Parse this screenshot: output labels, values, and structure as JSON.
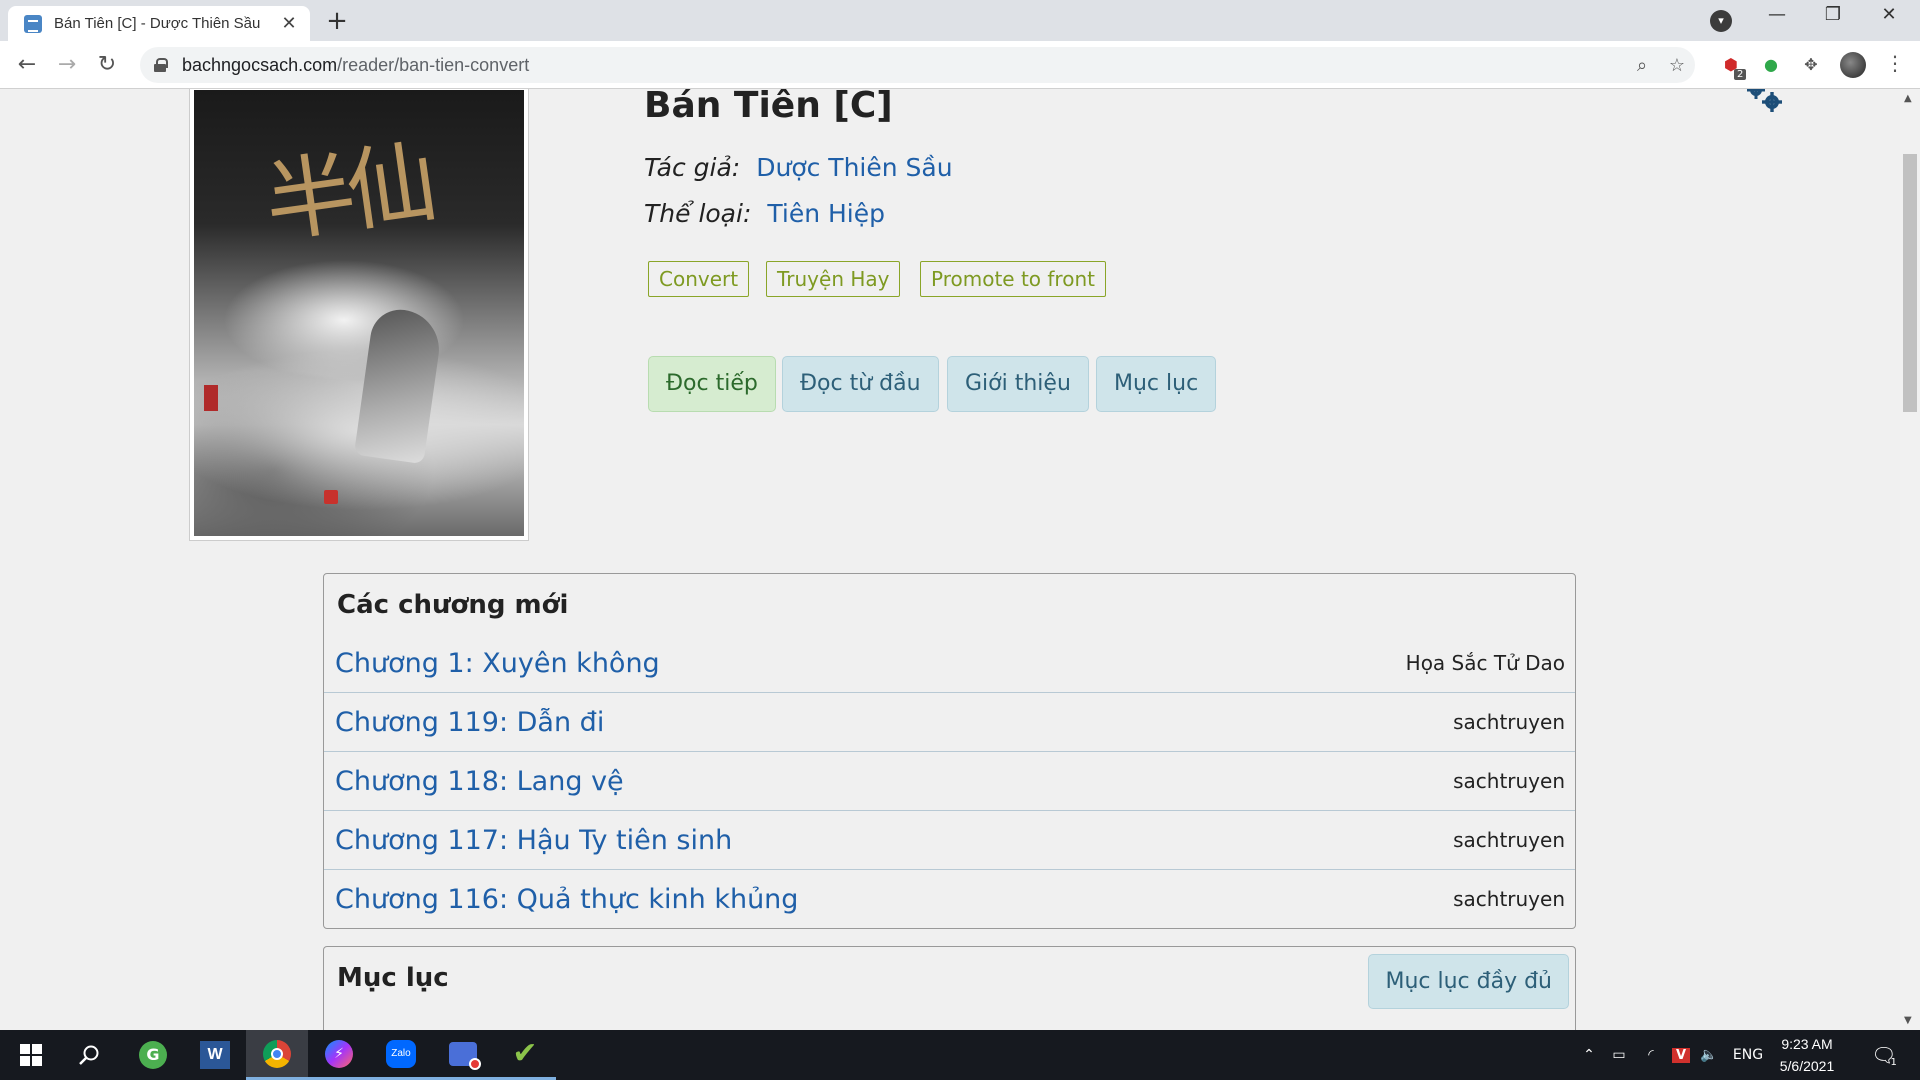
{
  "browser": {
    "tab_title": "Bán Tiên [C] - Dược Thiên Sầu",
    "tab_close": "✕",
    "new_tab": "+",
    "url_domain": "bachngocsach.com",
    "url_path": "/reader/ban-tien-convert",
    "window_controls": {
      "minimize": "—",
      "maximize": "❐",
      "close": "✕"
    },
    "extension_badge": "2"
  },
  "book": {
    "title": "Bán Tiên [C]",
    "author_label": "Tác giả:",
    "author": "Dược Thiên Sầu",
    "genre_label": "Thể loại:",
    "genre": "Tiên Hiệp",
    "tags": [
      "Convert",
      "Truyện Hay",
      "Promote to front"
    ],
    "actions": {
      "continue": "Đọc tiếp",
      "from_start": "Đọc từ đầu",
      "intro": "Giới thiệu",
      "toc": "Mục lục"
    },
    "cover_title_art": "半仙"
  },
  "new_chapters": {
    "heading": "Các chương mới",
    "rows": [
      {
        "title": "Chương 1: Xuyên không",
        "author": "Họa Sắc Tử Dao"
      },
      {
        "title": "Chương 119: Dẫn đi",
        "author": "sachtruyen"
      },
      {
        "title": "Chương 118: Lang vệ",
        "author": "sachtruyen"
      },
      {
        "title": "Chương 117: Hậu Ty tiên sinh",
        "author": "sachtruyen"
      },
      {
        "title": "Chương 116: Quả thực kinh khủng",
        "author": "sachtruyen"
      }
    ]
  },
  "toc": {
    "heading": "Mục lục",
    "full_button": "Mục lục đầy đủ"
  },
  "taskbar": {
    "language": "ENG",
    "time": "9:23 AM",
    "date": "5/6/2021",
    "notification_count": "1"
  }
}
